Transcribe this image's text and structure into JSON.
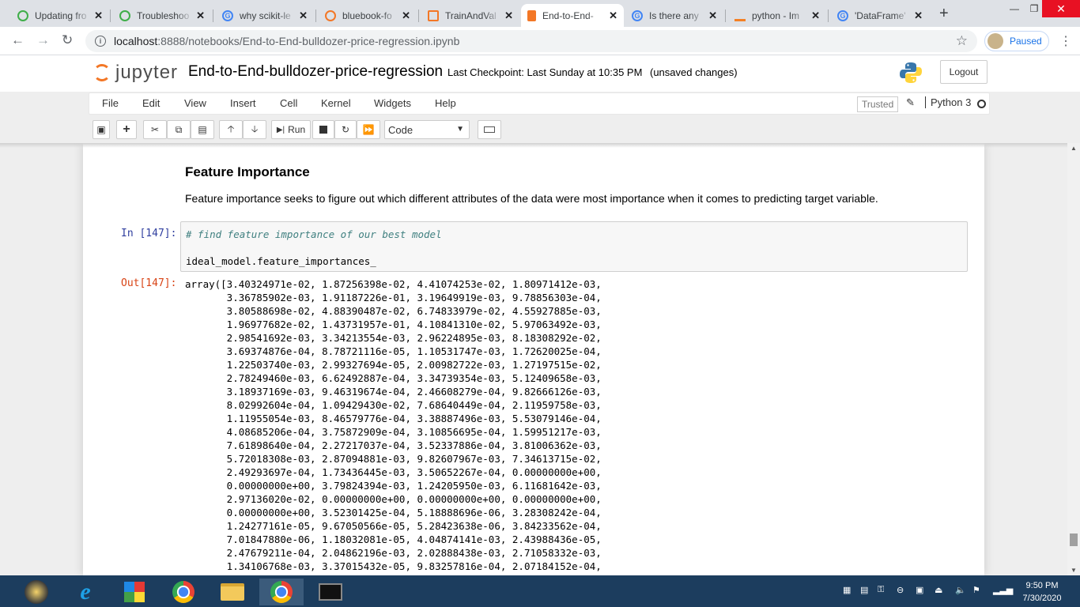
{
  "browser": {
    "tabs": [
      {
        "label": "Updating fro",
        "icon": "green-logo-icon"
      },
      {
        "label": "Troubleshoo",
        "icon": "green-logo-icon"
      },
      {
        "label": "why scikit-le",
        "icon": "google-icon"
      },
      {
        "label": "bluebook-fo",
        "icon": "orange-logo-icon"
      },
      {
        "label": "TrainAndVal",
        "icon": "orange-logo-icon"
      },
      {
        "label": "End-to-End-",
        "icon": "jupyter-tab-icon",
        "active": true
      },
      {
        "label": "Is there any",
        "icon": "google-icon"
      },
      {
        "label": "python - Im",
        "icon": "stackoverflow-icon"
      },
      {
        "label": "'DataFrame'",
        "icon": "google-icon"
      }
    ],
    "url_host": "localhost",
    "url_rest": ":8888/notebooks/End-to-End-bulldozer-price-regression.ipynb",
    "profile_label": "Paused"
  },
  "jupyter": {
    "logo_text": "jupyter",
    "notebook_title": "End-to-End-bulldozer-price-regression",
    "checkpoint": "Last Checkpoint: Last Sunday at 10:35 PM",
    "unsaved": "(unsaved changes)",
    "logout_label": "Logout",
    "menu": [
      "File",
      "Edit",
      "View",
      "Insert",
      "Cell",
      "Kernel",
      "Widgets",
      "Help"
    ],
    "trusted_label": "Trusted",
    "kernel_name": "Python 3",
    "toolbar": {
      "run_label": "Run",
      "cell_type": "Code"
    }
  },
  "notebook": {
    "heading": "Feature Importance",
    "paragraph": "Feature importance seeks to figure out which different attributes of the data were most importance when it comes to predicting target variable.",
    "in_prompt": "In [147]:",
    "code_comment": "# find feature importance of our best model",
    "code_line": "ideal_model.feature_importances_",
    "out_prompt": "Out[147]:",
    "output_lines": [
      "array([3.40324971e-02, 1.87256398e-02, 4.41074253e-02, 1.80971412e-03,",
      "       3.36785902e-03, 1.91187226e-01, 3.19649919e-03, 9.78856303e-04,",
      "       3.80588698e-02, 4.88390487e-02, 6.74833979e-02, 4.55927885e-03,",
      "       1.96977682e-02, 1.43731957e-01, 4.10841310e-02, 5.97063492e-03,",
      "       2.98541692e-03, 3.34213554e-03, 2.96224895e-03, 8.18308292e-02,",
      "       3.69374876e-04, 8.78721116e-05, 1.10531747e-03, 1.72620025e-04,",
      "       1.22503740e-03, 2.99327694e-05, 2.00982722e-03, 1.27197515e-02,",
      "       2.78249460e-03, 6.62492887e-04, 3.34739354e-03, 5.12409658e-03,",
      "       3.18937169e-03, 9.46319674e-04, 2.46608279e-04, 9.82666126e-03,",
      "       8.02992604e-04, 1.09429430e-02, 7.68640449e-04, 2.11959758e-03,",
      "       1.11955054e-03, 8.46579776e-04, 3.38887496e-03, 5.53079146e-04,",
      "       4.08685206e-04, 3.75872909e-04, 3.10856695e-04, 1.59951217e-03,",
      "       7.61898640e-04, 2.27217037e-04, 3.52337886e-04, 3.81006362e-03,",
      "       5.72018308e-03, 2.87094881e-03, 9.82607967e-03, 7.34613715e-02,",
      "       2.49293697e-04, 1.73436445e-03, 3.50652267e-04, 0.00000000e+00,",
      "       0.00000000e+00, 3.79824394e-03, 1.24205950e-03, 6.11681642e-03,",
      "       2.97136020e-02, 0.00000000e+00, 0.00000000e+00, 0.00000000e+00,",
      "       0.00000000e+00, 3.52301425e-04, 5.18888696e-06, 3.28308242e-04,",
      "       1.24277161e-05, 9.67050566e-05, 5.28423638e-06, 3.84233562e-04,",
      "       7.01847880e-06, 1.18032081e-05, 4.04874141e-03, 2.43988436e-05,",
      "       2.47679211e-04, 2.04862196e-03, 2.02888438e-03, 2.71058332e-03,",
      "       1.34106768e-03, 3.37015432e-05, 9.83257816e-04, 2.07184152e-04,"
    ]
  },
  "taskbar": {
    "time": "9:50 PM",
    "date": "7/30/2020"
  }
}
